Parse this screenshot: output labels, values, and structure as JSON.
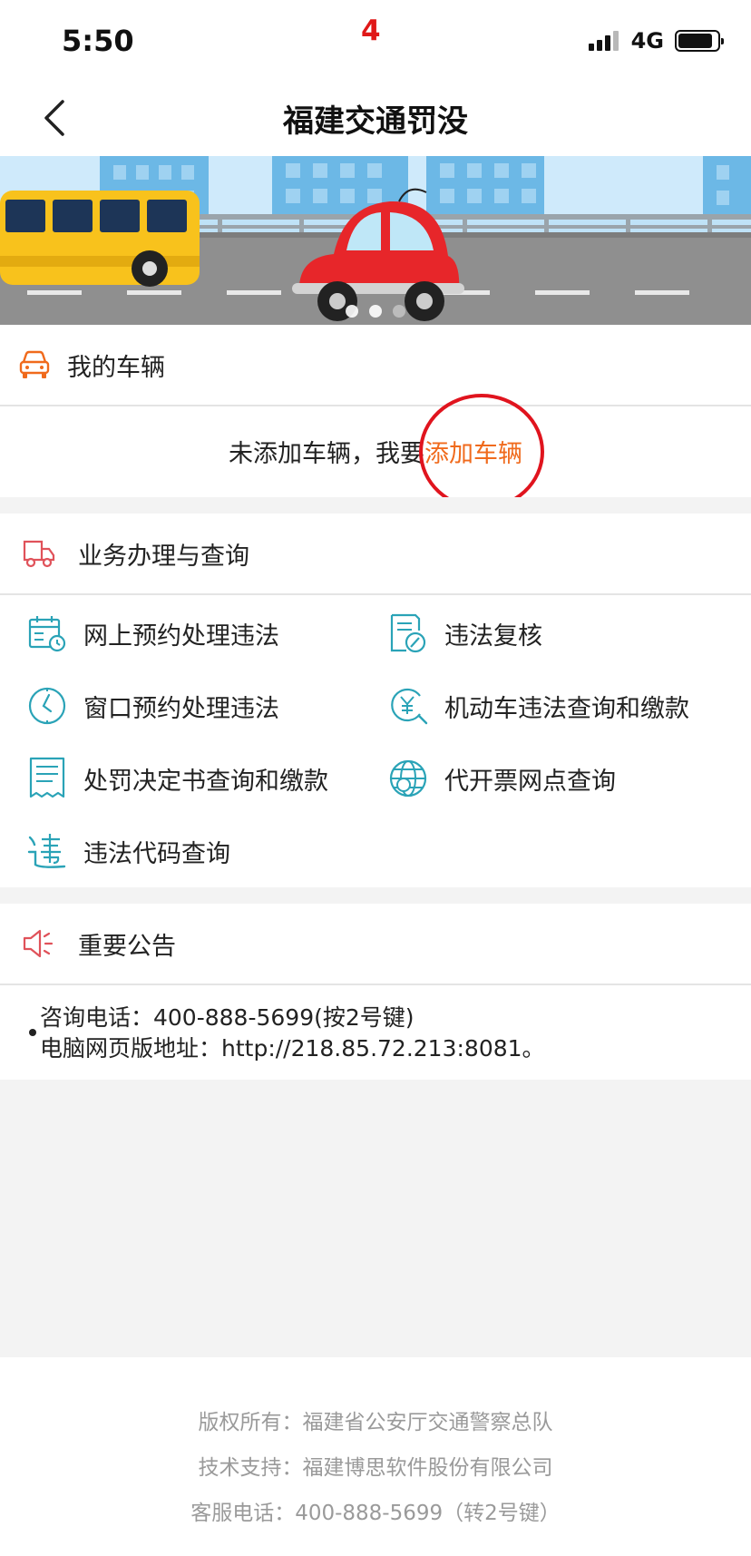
{
  "status_bar": {
    "time": "5:50",
    "marker": "4",
    "network": "4G"
  },
  "nav": {
    "title": "福建交通罚没"
  },
  "my_vehicle": {
    "title": "我的车辆",
    "empty_prefix": "未添加车辆，我要",
    "add_link": "添加车辆"
  },
  "business": {
    "title": "业务办理与查询",
    "items": [
      {
        "label": "网上预约处理违法",
        "icon": "calendar-icon"
      },
      {
        "label": "违法复核",
        "icon": "review-pen-icon"
      },
      {
        "label": "窗口预约处理违法",
        "icon": "clock-icon"
      },
      {
        "label": "机动车违法查询和缴款",
        "icon": "yen-search-icon"
      },
      {
        "label": "处罚决定书查询和缴款",
        "icon": "receipt-icon"
      },
      {
        "label": "代开票网点查询",
        "icon": "globe-icon"
      },
      {
        "label": "违法代码查询",
        "icon": "violation-code-icon"
      }
    ]
  },
  "notice": {
    "title": "重要公告",
    "lines": [
      "咨询电话：400-888-5699(按2号键)",
      "电脑网页版地址：http://218.85.72.213:8081。"
    ]
  },
  "footer": {
    "copyright": "版权所有：福建省公安厅交通警察总队",
    "support": "技术支持：福建博思软件股份有限公司",
    "service": "客服电话：400-888-5699（转2号键）"
  },
  "colors": {
    "accent": "#f06a1c",
    "teal": "#2aa3b7",
    "red_icon": "#e0525a",
    "annotation": "#e0141e"
  }
}
